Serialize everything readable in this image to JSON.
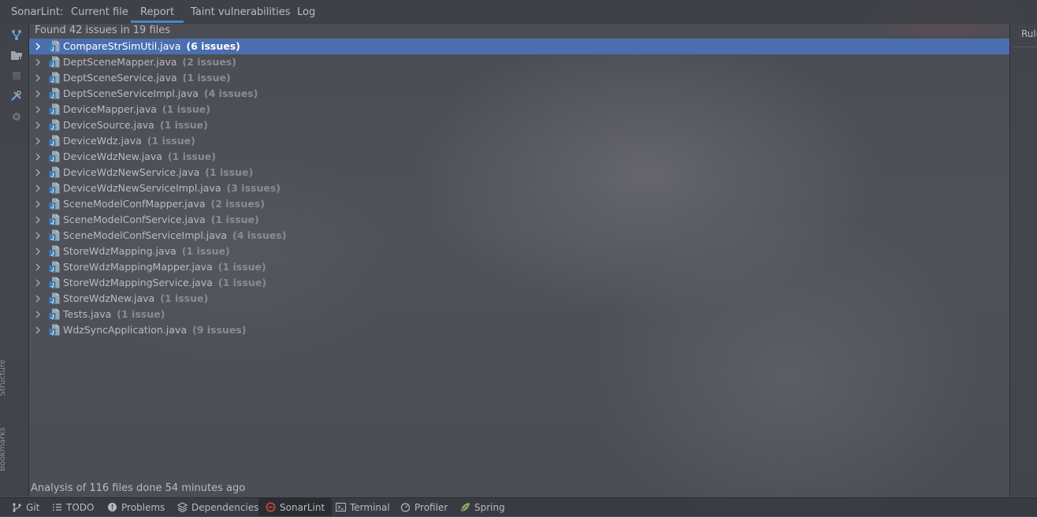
{
  "toolwindow": {
    "title": "SonarLint:",
    "tabs": [
      {
        "label": "Current file"
      },
      {
        "label": "Report",
        "active": true
      },
      {
        "label": "Taint vulnerabilities"
      },
      {
        "label": "Log"
      }
    ]
  },
  "report": {
    "summary": "Found 42 issues in 19 files",
    "files": [
      {
        "name": "CompareStrSimUtil.java",
        "count": "(6 issues)",
        "selected": true
      },
      {
        "name": "DeptSceneMapper.java",
        "count": "(2 issues)"
      },
      {
        "name": "DeptSceneService.java",
        "count": "(1 issue)"
      },
      {
        "name": "DeptSceneServiceImpl.java",
        "count": "(4 issues)"
      },
      {
        "name": "DeviceMapper.java",
        "count": "(1 issue)"
      },
      {
        "name": "DeviceSource.java",
        "count": "(1 issue)"
      },
      {
        "name": "DeviceWdz.java",
        "count": "(1 issue)"
      },
      {
        "name": "DeviceWdzNew.java",
        "count": "(1 issue)"
      },
      {
        "name": "DeviceWdzNewService.java",
        "count": "(1 issue)"
      },
      {
        "name": "DeviceWdzNewServiceImpl.java",
        "count": "(3 issues)"
      },
      {
        "name": "SceneModelConfMapper.java",
        "count": "(2 issues)"
      },
      {
        "name": "SceneModelConfService.java",
        "count": "(1 issue)"
      },
      {
        "name": "SceneModelConfServiceImpl.java",
        "count": "(4 issues)"
      },
      {
        "name": "StoreWdzMapping.java",
        "count": "(1 issue)"
      },
      {
        "name": "StoreWdzMappingMapper.java",
        "count": "(1 issue)"
      },
      {
        "name": "StoreWdzMappingService.java",
        "count": "(1 issue)"
      },
      {
        "name": "StoreWdzNew.java",
        "count": "(1 issue)"
      },
      {
        "name": "Tests.java",
        "count": "(1 issue)"
      },
      {
        "name": "WdzSyncApplication.java",
        "count": "(9 issues)"
      }
    ],
    "status": "Analysis of 116 files done 54 minutes ago"
  },
  "right_panel": {
    "tab": "Rule"
  },
  "side_labels": {
    "structure": "Structure",
    "bookmarks": "Bookmarks"
  },
  "bottom_tools": [
    {
      "label": "Git",
      "icon": "git-branch-icon"
    },
    {
      "label": "TODO",
      "icon": "todo-list-icon"
    },
    {
      "label": "Problems",
      "icon": "problems-icon"
    },
    {
      "label": "Dependencies",
      "icon": "dependencies-icon"
    },
    {
      "label": "SonarLint",
      "icon": "sonarlint-icon",
      "active": true
    },
    {
      "label": "Terminal",
      "icon": "terminal-icon"
    },
    {
      "label": "Profiler",
      "icon": "profiler-icon"
    },
    {
      "label": "Spring",
      "icon": "spring-leaf-icon"
    }
  ],
  "colors": {
    "selection": "#4b6eaf",
    "accent": "#4a88c7",
    "sonar_red": "#d0453e",
    "file_icon": "#3d7fb8"
  }
}
